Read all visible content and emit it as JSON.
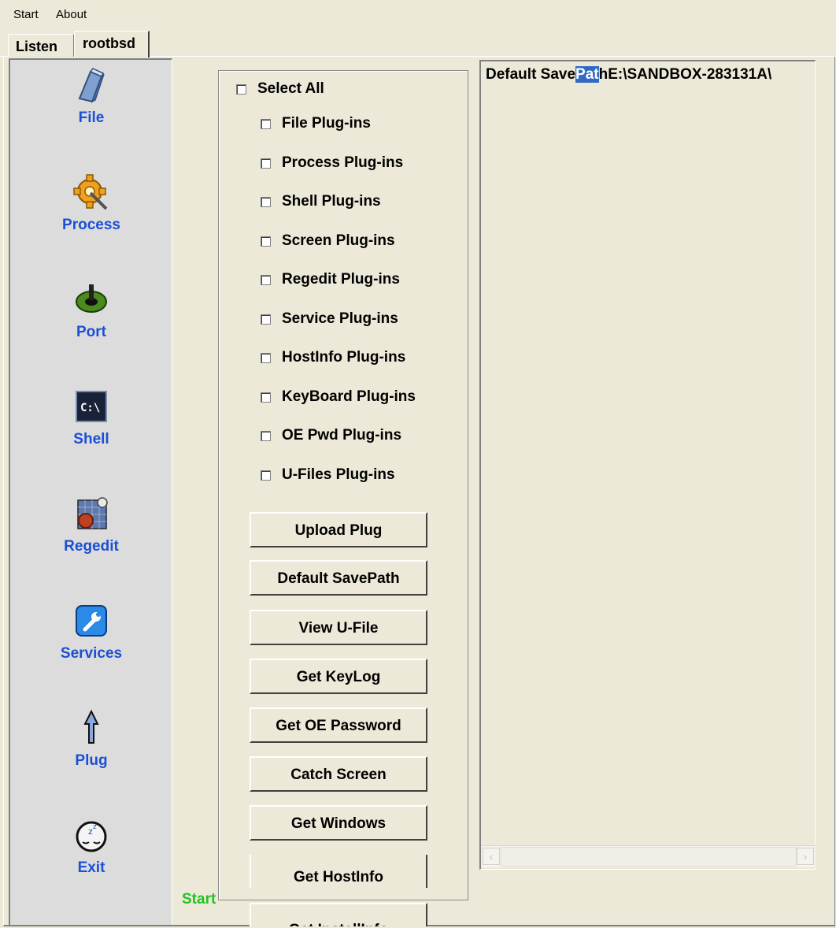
{
  "menubar": {
    "items": [
      "Start",
      "About"
    ]
  },
  "tabs": [
    {
      "label": "Listen"
    },
    {
      "label": "rootbsd",
      "active": true
    }
  ],
  "sidebar": {
    "items": [
      {
        "label": "File",
        "icon": "book-icon"
      },
      {
        "label": "Process",
        "icon": "gear-icon"
      },
      {
        "label": "Port",
        "icon": "port-plug-icon"
      },
      {
        "label": "Shell",
        "icon": "command-prompt-icon"
      },
      {
        "label": "Regedit",
        "icon": "registry-icon"
      },
      {
        "label": "Services",
        "icon": "wrench-icon"
      },
      {
        "label": "Plug",
        "icon": "upload-arrow-icon"
      },
      {
        "label": "Exit",
        "icon": "sleep-clock-icon"
      }
    ]
  },
  "plugins": {
    "select_all": "Select All",
    "items": [
      "File Plug-ins",
      "Process Plug-ins",
      "Shell Plug-ins",
      "Screen Plug-ins",
      "Regedit Plug-ins",
      "Service Plug-ins",
      "HostInfo Plug-ins",
      "KeyBoard Plug-ins",
      "OE Pwd Plug-ins",
      "U-Files Plug-ins"
    ]
  },
  "buttons": [
    "Upload Plug",
    "Default SavePath",
    "View U-File",
    "Get KeyLog",
    "Get OE Password",
    "Catch Screen",
    "Get Windows",
    "Get HostInfo",
    "Get InstallInfo"
  ],
  "output": {
    "before": "Default Save",
    "selected": "Pat",
    "after": "hE:\\SANDBOX-283131A\\"
  },
  "status": {
    "text": "Start",
    "color": "#22c322"
  },
  "colors": {
    "background": "#ece9d8",
    "sidebar": "#dcdcdc",
    "accent": "#1a4fd6",
    "selection": "#316ac5"
  }
}
